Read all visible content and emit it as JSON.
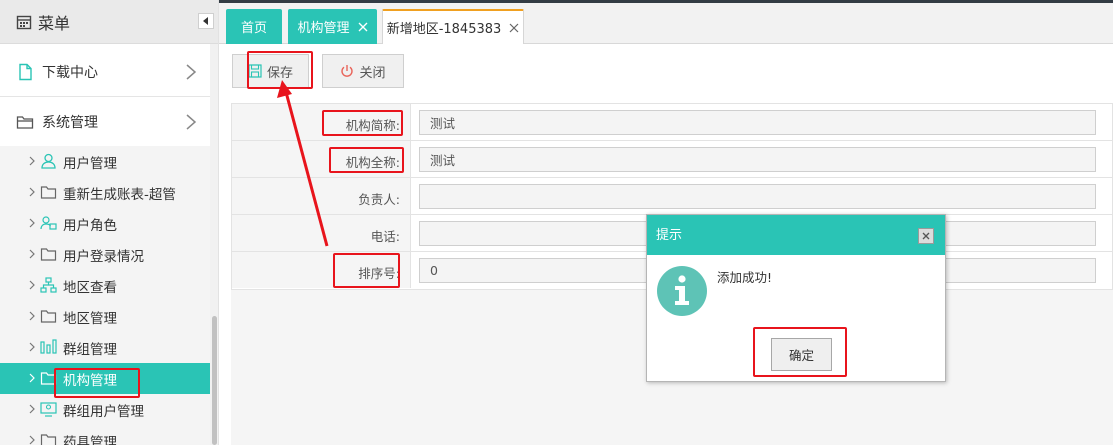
{
  "sidebar": {
    "title": "菜单",
    "title_icon": "calendar-icon",
    "groups": [
      {
        "label": "下载中心",
        "icon": "document-icon"
      },
      {
        "label": "系统管理",
        "icon": "folder-icon"
      }
    ],
    "items": [
      {
        "label": "用户管理",
        "icon": "user-icon"
      },
      {
        "label": "重新生成账表-超管",
        "icon": "folder-icon"
      },
      {
        "label": "用户角色",
        "icon": "user-role-icon"
      },
      {
        "label": "用户登录情况",
        "icon": "folder-icon"
      },
      {
        "label": "地区查看",
        "icon": "hierarchy-icon"
      },
      {
        "label": "地区管理",
        "icon": "folder-icon"
      },
      {
        "label": "群组管理",
        "icon": "group-chart-icon"
      },
      {
        "label": "机构管理",
        "icon": "folder-icon",
        "active": true
      },
      {
        "label": "群组用户管理",
        "icon": "monitor-user-icon"
      },
      {
        "label": "药具管理",
        "icon": "folder-icon"
      }
    ]
  },
  "tabs": [
    {
      "label": "首页"
    },
    {
      "label": "机构管理",
      "closable": true
    },
    {
      "label": "新增地区-1845383",
      "closable": true,
      "active": true
    }
  ],
  "toolbar": {
    "save_label": "保存",
    "close_label": "关闭"
  },
  "form": {
    "rows": [
      {
        "label": "机构简称:",
        "value": "测试"
      },
      {
        "label": "机构全称:",
        "value": "测试"
      },
      {
        "label": "负责人:",
        "value": ""
      },
      {
        "label": "电话:",
        "value": ""
      },
      {
        "label": "排序号:",
        "value": "0"
      }
    ]
  },
  "dialog": {
    "title": "提示",
    "message": "添加成功!",
    "ok_label": "确定",
    "icon": "info-icon"
  },
  "colors": {
    "accent": "#2ac4b5",
    "annotation": "#e8141c",
    "active_tab_border": "#f0a020"
  }
}
